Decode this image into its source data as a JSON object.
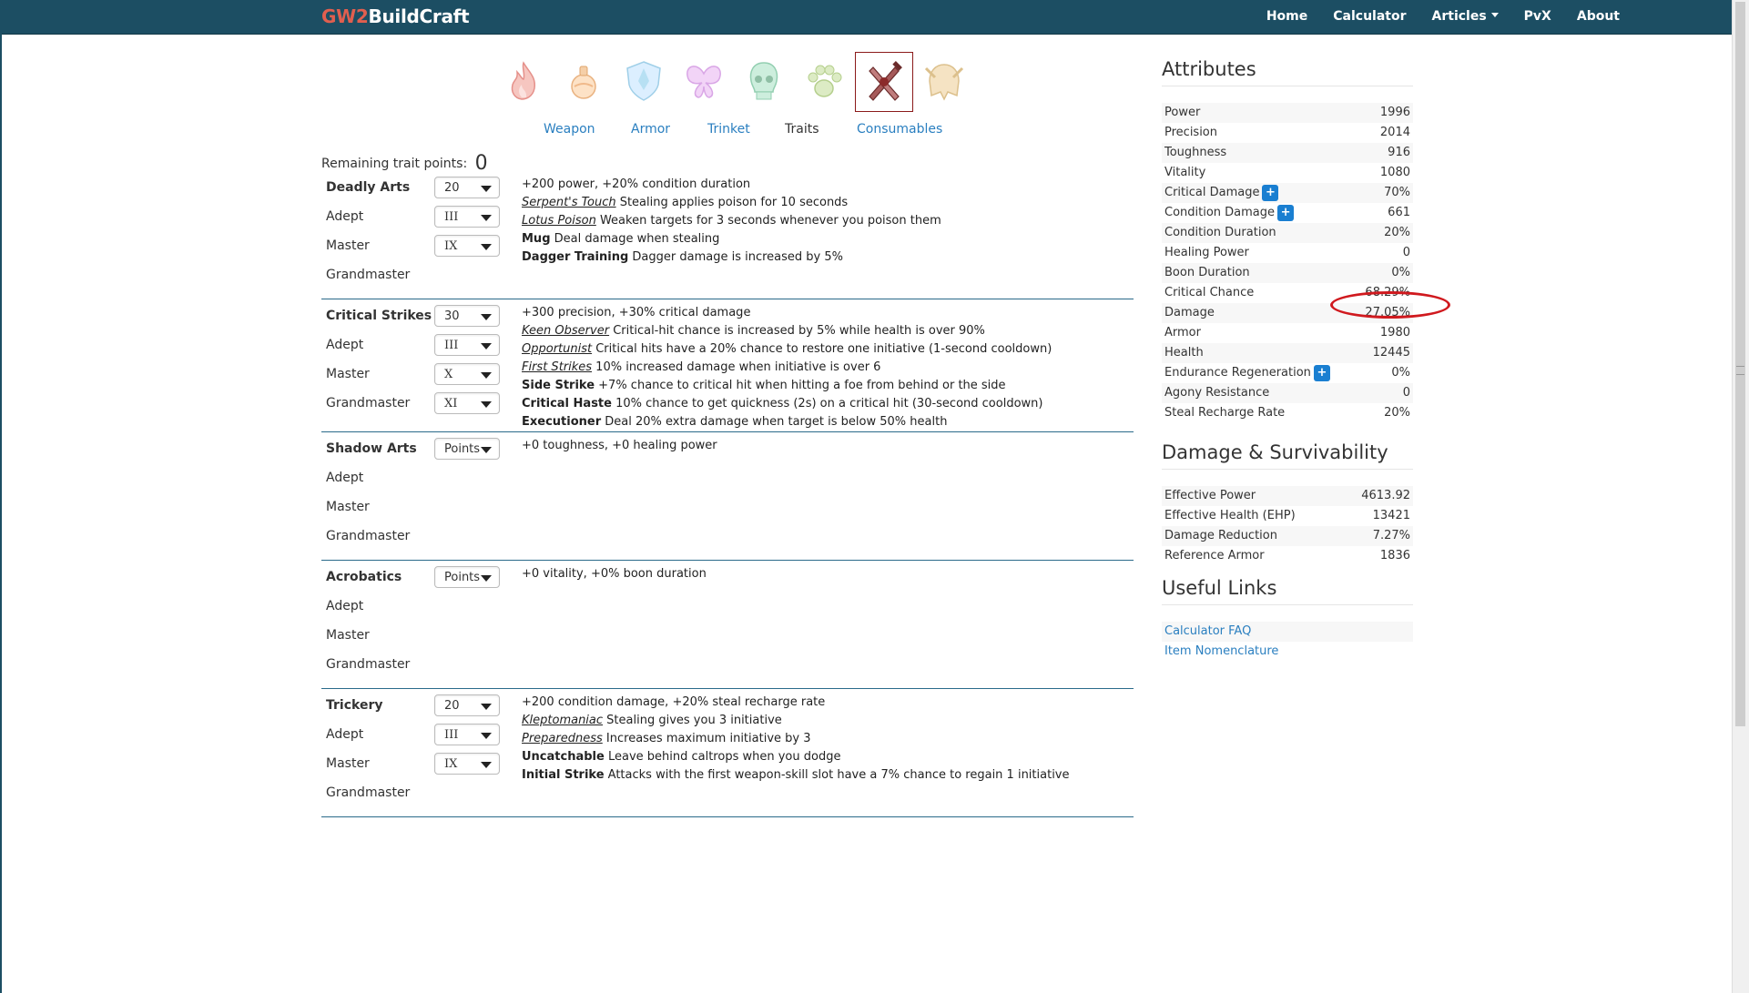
{
  "nav": {
    "brand_a": "GW2",
    "brand_b": "BuildCraft",
    "links": [
      "Home",
      "Calculator",
      "Articles",
      "PvX",
      "About"
    ]
  },
  "profession_icons": [
    "fire-icon",
    "potion-icon",
    "shield-icon",
    "butterfly-icon",
    "skull-icon",
    "paw-icon",
    "thief-icon",
    "helmet-icon"
  ],
  "tabs": [
    "Weapon",
    "Armor",
    "Trinket",
    "Traits",
    "Consumables"
  ],
  "active_tab": "Traits",
  "remaining": {
    "label": "Remaining trait points:",
    "value": "0"
  },
  "trees": [
    {
      "name": "Deadly Arts",
      "points": "20",
      "adept": "III",
      "master": "IX",
      "grandmaster": "",
      "labels": [
        "Adept",
        "Master",
        "Grandmaster"
      ],
      "summary": "+200 power, +20% condition duration",
      "traits": [
        {
          "name": "Serpent's Touch",
          "minor": false,
          "text": "Stealing applies poison for 10 seconds"
        },
        {
          "name": "Lotus Poison",
          "minor": false,
          "text": "Weaken targets for 3 seconds whenever you poison them"
        },
        {
          "name": "Mug",
          "minor": true,
          "text": "Deal damage when stealing"
        },
        {
          "name": "Dagger Training",
          "minor": true,
          "text": "Dagger damage is increased by 5%"
        }
      ]
    },
    {
      "name": "Critical Strikes",
      "points": "30",
      "adept": "III",
      "master": "X",
      "grandmaster": "XI",
      "labels": [
        "Adept",
        "Master",
        "Grandmaster"
      ],
      "summary": "+300 precision, +30% critical damage",
      "traits": [
        {
          "name": "Keen Observer",
          "minor": false,
          "text": "Critical-hit chance is increased by 5% while health is over 90%"
        },
        {
          "name": "Opportunist",
          "minor": false,
          "text": "Critical hits have a 20% chance to restore one initiative (1-second cooldown)"
        },
        {
          "name": "First Strikes",
          "minor": false,
          "text": "10% increased damage when initiative is over 6"
        },
        {
          "name": "Side Strike",
          "minor": true,
          "text": "+7% chance to critical hit when hitting a foe from behind or the side"
        },
        {
          "name": "Critical Haste",
          "minor": true,
          "text": "10% chance to get quickness (2s) on a critical hit (30-second cooldown)"
        },
        {
          "name": "Executioner",
          "minor": true,
          "text": "Deal 20% extra damage when target is below 50% health"
        }
      ]
    },
    {
      "name": "Shadow Arts",
      "points": "Points",
      "adept": "",
      "master": "",
      "grandmaster": "",
      "labels": [
        "Adept",
        "Master",
        "Grandmaster"
      ],
      "summary": "+0 toughness, +0 healing power",
      "traits": []
    },
    {
      "name": "Acrobatics",
      "points": "Points",
      "adept": "",
      "master": "",
      "grandmaster": "",
      "labels": [
        "Adept",
        "Master",
        "Grandmaster"
      ],
      "summary": "+0 vitality, +0% boon duration",
      "traits": []
    },
    {
      "name": "Trickery",
      "points": "20",
      "adept": "III",
      "master": "IX",
      "grandmaster": "",
      "labels": [
        "Adept",
        "Master",
        "Grandmaster"
      ],
      "summary": "+200 condition damage, +20% steal recharge rate",
      "traits": [
        {
          "name": "Kleptomaniac",
          "minor": false,
          "text": "Stealing gives you 3 initiative"
        },
        {
          "name": "Preparedness",
          "minor": false,
          "text": "Increases maximum initiative by 3"
        },
        {
          "name": "Uncatchable",
          "minor": true,
          "text": "Leave behind caltrops when you dodge"
        },
        {
          "name": "Initial Strike",
          "minor": true,
          "text": "Attacks with the first weapon-skill slot have a 7% chance to regain 1 initiative"
        }
      ]
    }
  ],
  "attributes": {
    "title": "Attributes",
    "rows": [
      {
        "label": "Power",
        "value": "1996",
        "plus": false
      },
      {
        "label": "Precision",
        "value": "2014",
        "plus": false
      },
      {
        "label": "Toughness",
        "value": "916",
        "plus": false
      },
      {
        "label": "Vitality",
        "value": "1080",
        "plus": false
      },
      {
        "label": "Critical Damage",
        "value": "70%",
        "plus": true
      },
      {
        "label": "Condition Damage",
        "value": "661",
        "plus": true
      },
      {
        "label": "Condition Duration",
        "value": "20%",
        "plus": false
      },
      {
        "label": "Healing Power",
        "value": "0",
        "plus": false
      },
      {
        "label": "Boon Duration",
        "value": "0%",
        "plus": false
      },
      {
        "label": "Critical Chance",
        "value": "68.29%",
        "plus": false
      },
      {
        "label": "Damage",
        "value": "27.05%",
        "plus": false
      },
      {
        "label": "Armor",
        "value": "1980",
        "plus": false
      },
      {
        "label": "Health",
        "value": "12445",
        "plus": false
      },
      {
        "label": "Endurance Regeneration",
        "value": "0%",
        "plus": true
      },
      {
        "label": "Agony Resistance",
        "value": "0",
        "plus": false
      },
      {
        "label": "Steal Recharge Rate",
        "value": "20%",
        "plus": false
      }
    ]
  },
  "damage": {
    "title": "Damage & Survivability",
    "rows": [
      {
        "label": "Effective Power",
        "value": "4613.92"
      },
      {
        "label": "Effective Health (EHP)",
        "value": "13421"
      },
      {
        "label": "Damage Reduction",
        "value": "7.27%"
      },
      {
        "label": "Reference Armor",
        "value": "1836"
      }
    ]
  },
  "links": {
    "title": "Useful Links",
    "items": [
      "Calculator FAQ",
      "Item Nomenclature"
    ]
  },
  "plus_label": "+",
  "highlight_color": "#d0191e"
}
